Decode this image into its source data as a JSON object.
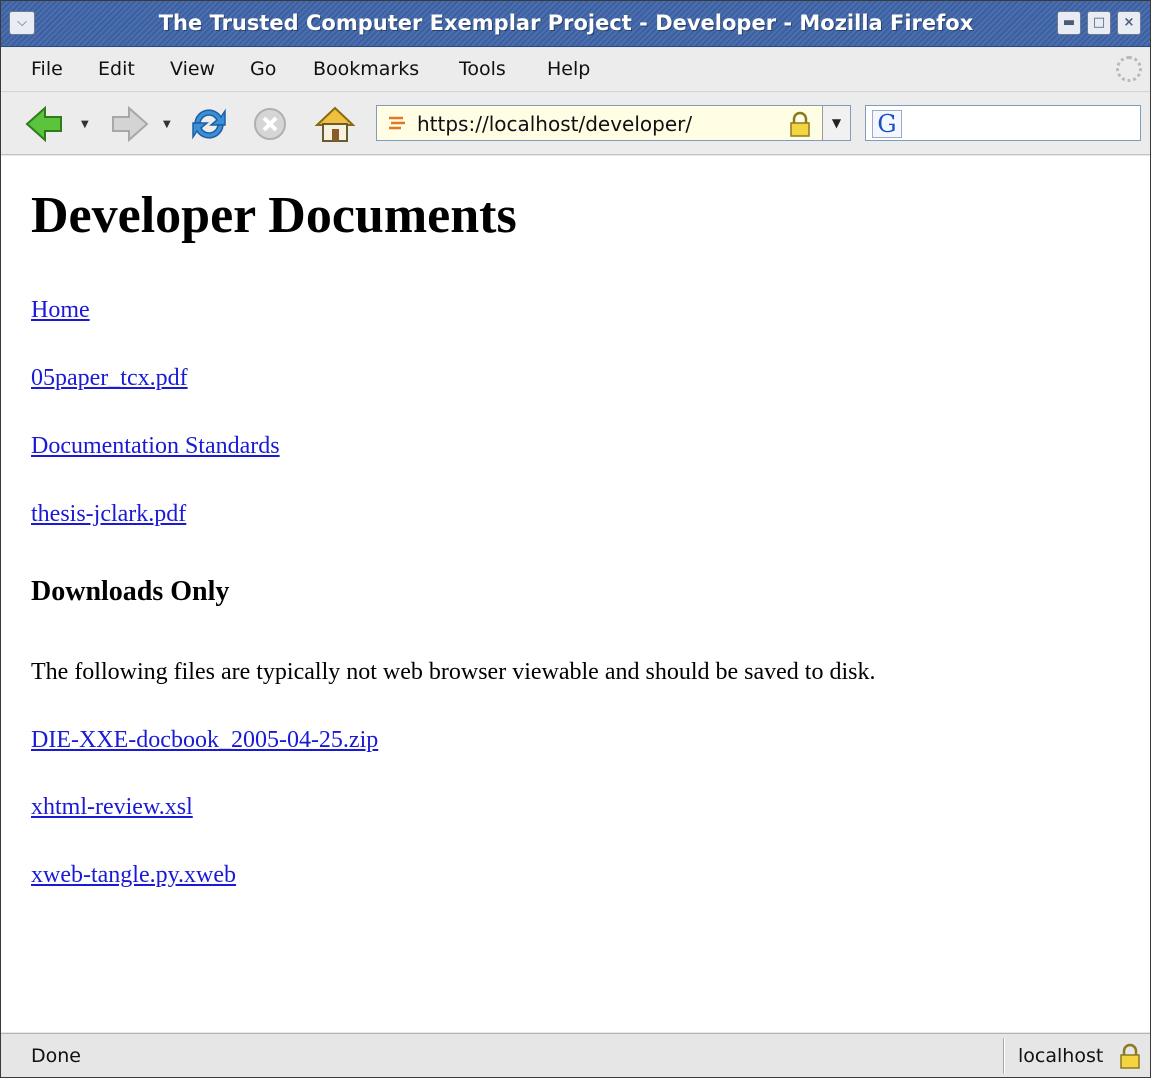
{
  "window": {
    "title": "The Trusted Computer Exemplar Project - Developer - Mozilla Firefox"
  },
  "menu": {
    "items": [
      {
        "label": "File"
      },
      {
        "label": "Edit"
      },
      {
        "label": "View"
      },
      {
        "label": "Go"
      },
      {
        "label": "Bookmarks"
      },
      {
        "label": "Tools"
      },
      {
        "label": "Help"
      }
    ]
  },
  "toolbar": {
    "url": "https://localhost/developer/",
    "search_engine_icon": "google-icon",
    "search_value": ""
  },
  "page": {
    "heading": "Developer Documents",
    "links": [
      {
        "label": "Home"
      },
      {
        "label": "05paper_tcx.pdf"
      },
      {
        "label": "Documentation Standards"
      },
      {
        "label": "thesis-jclark.pdf"
      }
    ],
    "downloads_heading": "Downloads Only",
    "downloads_note": "The following files are typically not web browser viewable and should be saved to disk.",
    "download_links": [
      {
        "label": "DIE-XXE-docbook_2005-04-25.zip"
      },
      {
        "label": "xhtml-review.xsl"
      },
      {
        "label": "xweb-tangle.py.xweb"
      }
    ]
  },
  "status": {
    "text": "Done",
    "host": "localhost"
  },
  "colors": {
    "link": "#1a1ad6",
    "titlebar": "#4a6fb0",
    "url_background": "#fffde4"
  }
}
